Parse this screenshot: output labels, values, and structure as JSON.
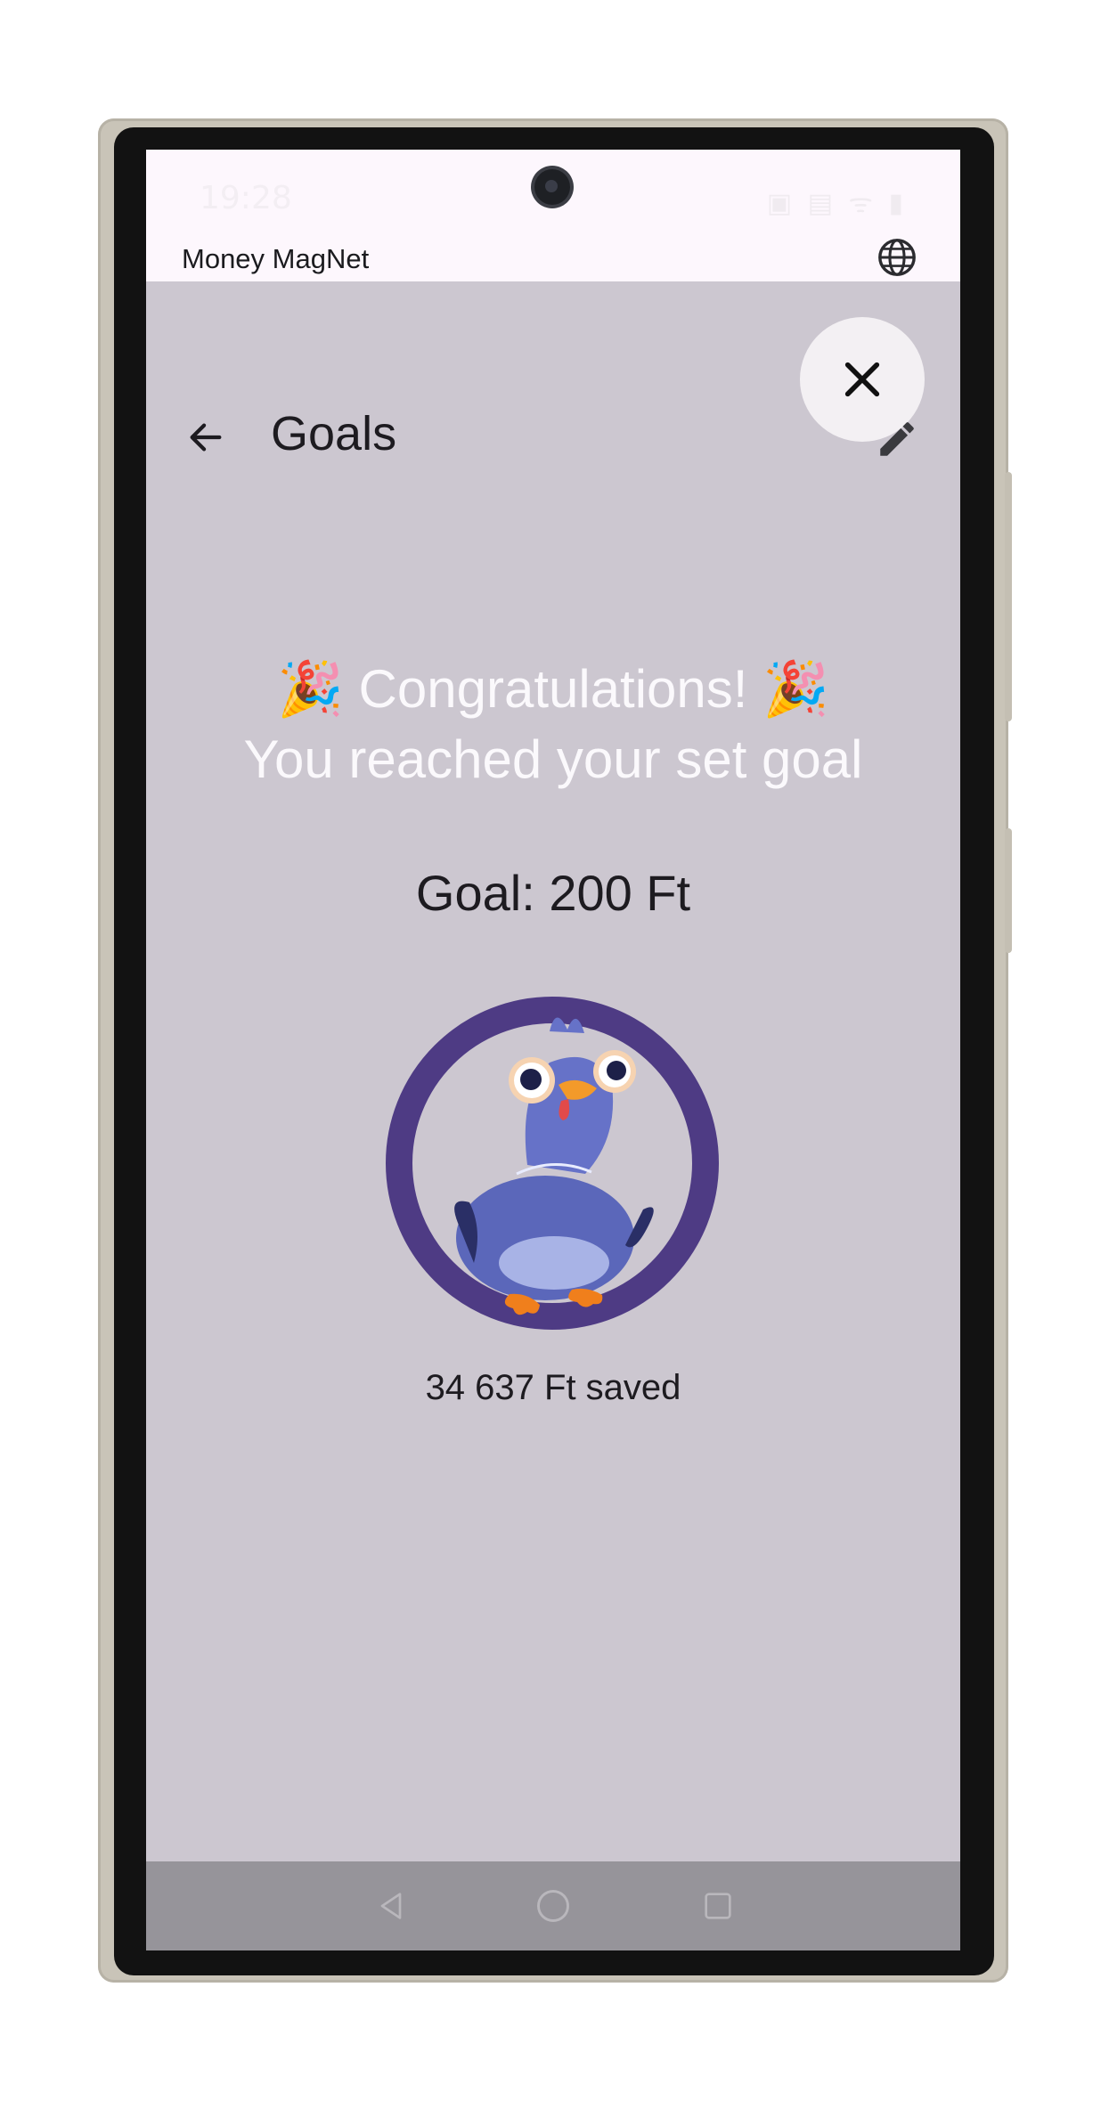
{
  "status_bar": {
    "time": "19:28",
    "icons": "▣ ▤ ᯤ ▮"
  },
  "app": {
    "name": "Money MagNet"
  },
  "header": {
    "title": "Goals"
  },
  "congrats": {
    "line1": "🎉 Congratulations! 🎉",
    "line2": "You reached your set goal"
  },
  "goal": {
    "text": "Goal: 200 Ft"
  },
  "saved": {
    "text": "34 637 Ft saved"
  },
  "icons": {
    "globe": "globe-icon",
    "close": "close-icon",
    "back": "arrow-back-icon",
    "edit": "pencil-icon",
    "mascot": "pigeon-mascot",
    "nav_back": "triangle-back-icon",
    "nav_home": "circle-home-icon",
    "nav_recents": "square-recents-icon"
  },
  "colors": {
    "screen_bg": "#ccc7d0",
    "ring": "#4e3b84",
    "text_dark": "#1d1b20",
    "congrats_text": "#fbf9fc",
    "nav_bar": "#96949a"
  }
}
